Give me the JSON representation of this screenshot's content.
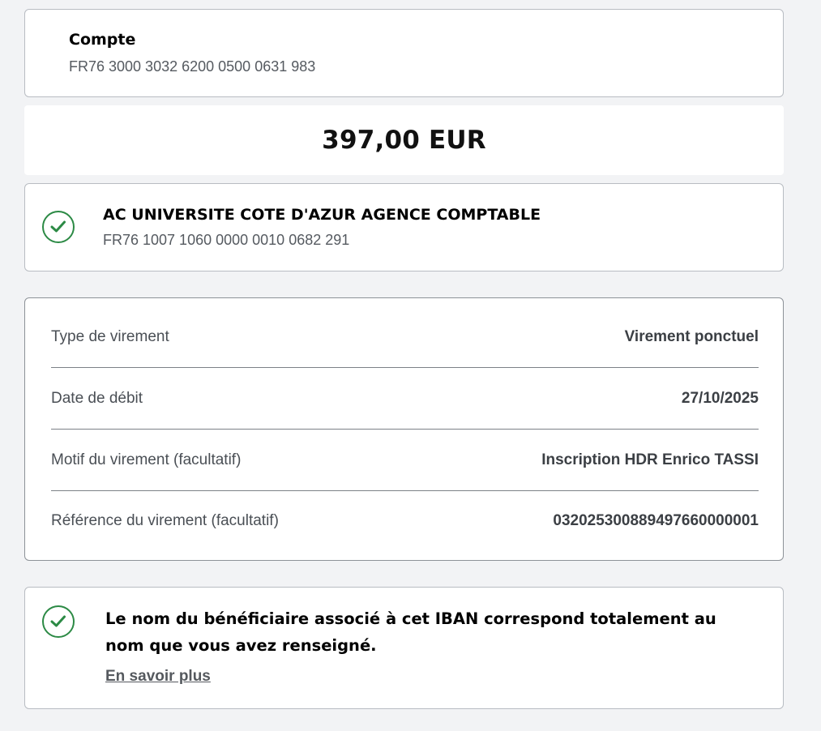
{
  "account": {
    "title": "Compte",
    "iban": "FR76 3000 3032 6200 0500 0631 983"
  },
  "amount": "397,00 EUR",
  "beneficiary": {
    "icon": "check-circle-icon",
    "name": "AC UNIVERSITE COTE D'AZUR AGENCE COMPTABLE",
    "iban": "FR76 1007 1060 0000 0010 0682 291"
  },
  "details": [
    {
      "label": "Type de virement",
      "value": "Virement ponctuel"
    },
    {
      "label": "Date de débit",
      "value": "27/10/2025"
    },
    {
      "label": "Motif du virement (facultatif)",
      "value": "Inscription HDR Enrico TASSI"
    },
    {
      "label": "Référence du virement (facultatif)",
      "value": "032025300889497660000001"
    }
  ],
  "match_notice": {
    "icon": "check-circle-icon",
    "message": "Le nom du bénéficiaire associé à cet IBAN correspond totalement au nom que vous avez renseigné.",
    "link": "En savoir plus"
  },
  "colors": {
    "success": "#2c8a45",
    "background": "#f2f3f5",
    "border": "#b8bcc2"
  }
}
